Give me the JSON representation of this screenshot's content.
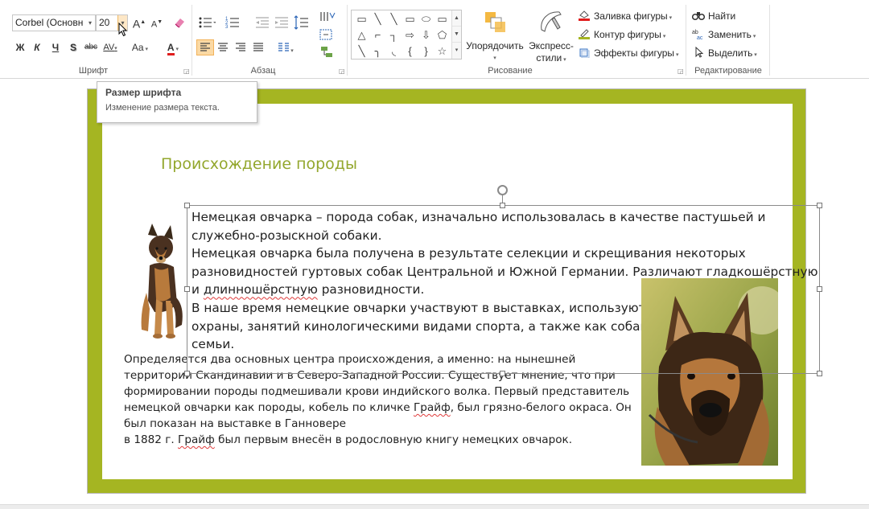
{
  "ribbon": {
    "font": {
      "label": "Шрифт",
      "font_name": "Corbel (Основн",
      "font_size": "20",
      "grow_icon": "A",
      "shrink_icon": "A",
      "bold": "Ж",
      "italic": "К",
      "underline": "Ч",
      "shadow": "S",
      "strike": "abc",
      "spacing": "AV",
      "case": "Aa",
      "color_letter": "A",
      "font_color": "#e01d1d"
    },
    "paragraph": {
      "label": "Абзац"
    },
    "drawing": {
      "label": "Рисование",
      "arrange_line1": "Упорядочить",
      "quick_styles_line1": "Экспресс-",
      "quick_styles_line2": "стили",
      "shape_fill": "Заливка фигуры",
      "shape_outline": "Контур фигуры",
      "shape_effects": "Эффекты фигуры",
      "shapes": [
        "▭",
        "╲",
        "╲",
        "▭",
        "⬭",
        "▭",
        "△",
        "⌐",
        "┐",
        "⇨",
        "⇩",
        "⬠",
        "╲",
        "╮",
        "◟",
        "{",
        "}",
        "☆"
      ]
    },
    "editing": {
      "label": "Редактирование",
      "find": "Найти",
      "replace": "Заменить",
      "select": "Выделить"
    }
  },
  "tooltip": {
    "title": "Размер шрифта",
    "description": "Изменение размера текста."
  },
  "slide": {
    "accent_color": "#a5b522",
    "title_color": "#93a72d",
    "title": "Происхождение породы",
    "body_lines": [
      "Немецкая овчарка – порода собак, изначально использовалась в качестве пастушьей и",
      "служебно-розыскной собаки.",
      "Немецкая овчарка была получена в результате селекции и скрещивания некоторых",
      "разновидностей гуртовых собак Центральной и Южной Германии. Различают гладкошёрстную",
      "и ",
      "длинношёрстную",
      " разновидности.",
      "В наше время немецкие овчарки участвуют в выставках, используются для",
      " охраны, занятий кинологическими видами спорта, а также как собаки для",
      "семьи."
    ],
    "lower_lines": [
      "Определяется два основных центра происхождения, а именно: на нынешней",
      "территории Скандинавии и в Северо-Западной России. Существует мнение, что при",
      "формировании породы подмешивали крови индийского волка. Первый представитель",
      "немецкой овчарки как породы, кобель по кличке ",
      "Грайф",
      ", был грязно-белого окраса. Он",
      "был показан на выставке в Ганновере",
      "в 1882 г. ",
      "Грайф",
      " был первым внесён в родословную книгу немецких овчарок."
    ]
  }
}
